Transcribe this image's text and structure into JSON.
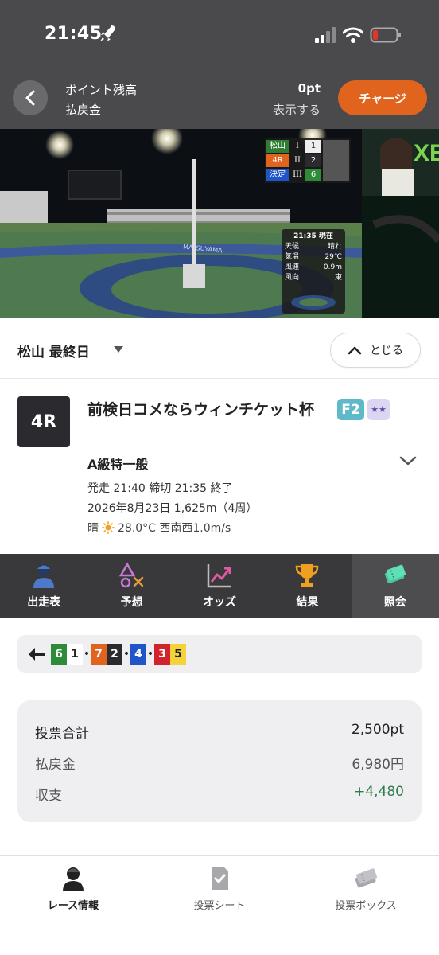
{
  "status_bar": {
    "time": "21:45"
  },
  "header": {
    "points_label": "ポイント残高",
    "refund_label": "払戻金",
    "points_value": "0pt",
    "show_label": "表示する",
    "charge_button": "チャージ"
  },
  "video": {
    "scoreboard": [
      {
        "left": "松山",
        "mid": "I",
        "right": "1"
      },
      {
        "left": "4R",
        "mid": "II",
        "right": "2"
      },
      {
        "left": "決定",
        "mid": "III",
        "right": "6"
      }
    ],
    "weather_panel": {
      "time": "21:35 現在",
      "rows": [
        {
          "label": "天候",
          "value": "晴れ"
        },
        {
          "label": "気温",
          "value": "29℃"
        },
        {
          "label": "風速",
          "value": "0.9m"
        },
        {
          "label": "風向",
          "value": "東"
        }
      ]
    },
    "stadium_text": "MATSUYAMA"
  },
  "venue": {
    "name": "松山 最終日",
    "close_button": "とじる"
  },
  "race": {
    "number": "4R",
    "title": "前検日コメならウィンチケット杯",
    "grade": "F2",
    "class": "A級特一般",
    "schedule": "発走 21:40 締切 21:35  終了",
    "date_distance": "2026年8月23日 1,625m（4周）",
    "weather": "晴",
    "weather_detail": "28.0°C 西南西1.0m/s"
  },
  "tabs": [
    {
      "label": "出走表",
      "icon": "rider-icon"
    },
    {
      "label": "予想",
      "icon": "prediction-icon"
    },
    {
      "label": "オッズ",
      "icon": "odds-chart-icon"
    },
    {
      "label": "結果",
      "icon": "trophy-icon"
    },
    {
      "label": "照会",
      "icon": "ticket-icon",
      "active": true
    }
  ],
  "result": {
    "chips": [
      {
        "num": "6",
        "bg": "#2e8b3a",
        "fg": "#ffffff"
      },
      {
        "num": "1",
        "bg": "#ffffff",
        "fg": "#222222"
      },
      {
        "sep": "•"
      },
      {
        "num": "7",
        "bg": "#e0641d",
        "fg": "#ffffff"
      },
      {
        "num": "2",
        "bg": "#2b2b2f",
        "fg": "#ffffff"
      },
      {
        "sep": "•"
      },
      {
        "num": "4",
        "bg": "#1f55c8",
        "fg": "#ffffff"
      },
      {
        "sep": "•"
      },
      {
        "num": "3",
        "bg": "#d0232b",
        "fg": "#ffffff"
      },
      {
        "num": "5",
        "bg": "#f4d23a",
        "fg": "#222222"
      }
    ]
  },
  "summary": {
    "total_label": "投票合計",
    "total_value": "2,500pt",
    "refund_label": "払戻金",
    "refund_value": "6,980円",
    "balance_label": "収支",
    "balance_value": "+4,480"
  },
  "bottom_nav": [
    {
      "label": "レース情報",
      "icon": "rider-icon",
      "active": true
    },
    {
      "label": "投票シート",
      "icon": "check-sheet-icon"
    },
    {
      "label": "投票ボックス",
      "icon": "tickets-icon"
    }
  ],
  "colors": {
    "header_bg": "#4a4a4c",
    "accent_orange": "#e0641d",
    "tab_bg": "#39393b",
    "positive_green": "#2f7d4e",
    "grade_f2": "#5fb9c9"
  }
}
